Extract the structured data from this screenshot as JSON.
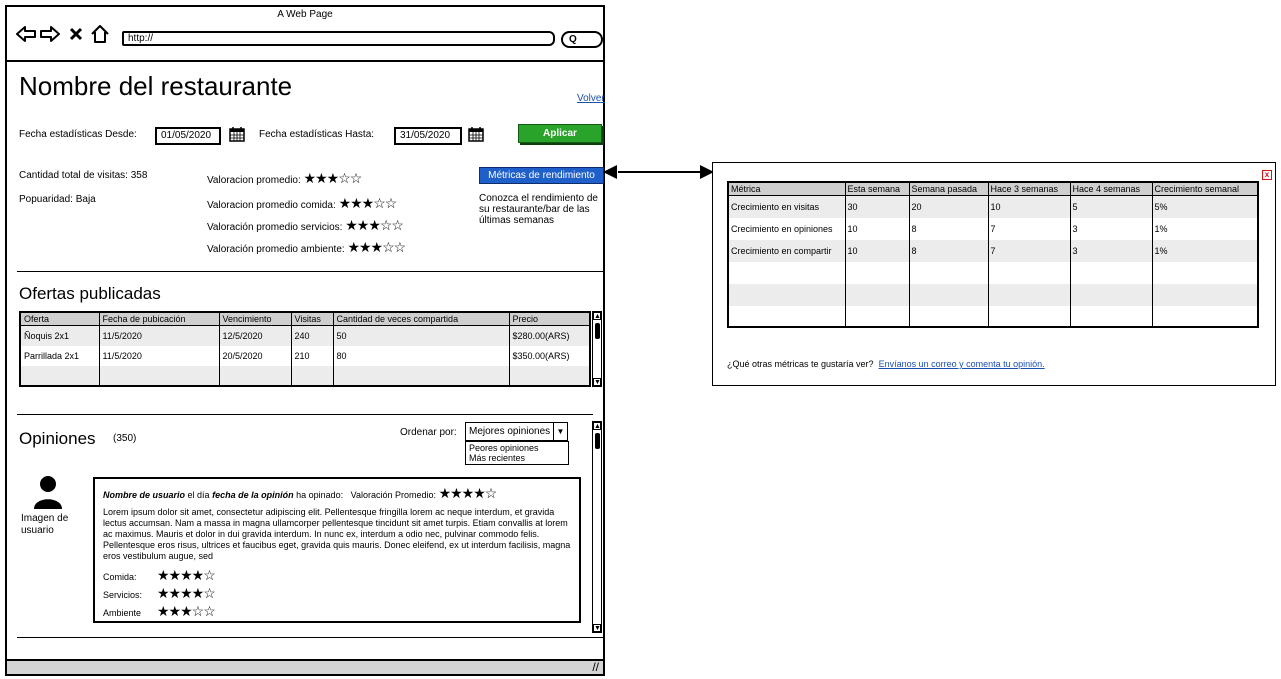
{
  "browser": {
    "title": "A Web Page",
    "url": "http://",
    "search_label": "Q"
  },
  "page": {
    "restaurant_name": "Nombre del restaurante",
    "volver": "Volver",
    "desde_label": "Fecha estadísticas Desde:",
    "desde_value": "01/05/2020",
    "hasta_label": "Fecha estadísticas Hasta:",
    "hasta_value": "31/05/2020",
    "aplicar": "Aplicar",
    "visitas": "Cantidad total de visitas: 358",
    "popularidad": "Popuaridad: Baja",
    "ratings": [
      {
        "label": "Valoracion promedio:",
        "stars": 3
      },
      {
        "label": "Valoracion promedio comida:",
        "stars": 3
      },
      {
        "label": "Valoración promedio servicios:",
        "stars": 3
      },
      {
        "label": "Valoración promedio ambiente:",
        "stars": 3
      }
    ],
    "metricas_button": "Métricas de rendimiento",
    "metricas_desc": "Conozca el rendimiento de su restaurante/bar de las últimas semanas"
  },
  "ofertas": {
    "title": "Ofertas publicadas",
    "columns": [
      "Oferta",
      "Fecha de pubicación",
      "Vencimiento",
      "Visitas",
      "Cantidad de veces compartida",
      "Precio"
    ],
    "rows": [
      [
        "Ñoquis 2x1",
        "11/5/2020",
        "12/5/2020",
        "240",
        "50",
        "$280.00(ARS)"
      ],
      [
        "Parrillada 2x1",
        "11/5/2020",
        "20/5/2020",
        "210",
        "80",
        "$350.00(ARS)"
      ]
    ]
  },
  "opiniones": {
    "title": "Opiniones",
    "count": "(350)",
    "ordenar_label": "Ordenar por:",
    "ordenar_selected": "Mejores opiniones",
    "ordenar_options": [
      "Peores opiniones",
      "Más recientes"
    ],
    "avatar_label": "Imagen de usuario",
    "review": {
      "user": "Nombre de usuario",
      "el_dia": "el día",
      "fecha": "fecha de la opinión",
      "ha_opinado": "ha opinado:",
      "valoracion_label": "Valoración Promedio:",
      "valoracion_stars": 4,
      "text": "Lorem ipsum dolor sit amet, consectetur adipiscing elit. Pellentesque fringilla lorem ac neque interdum, et gravida lectus accumsan. Nam a massa in magna ullamcorper pellentesque tincidunt sit amet turpis. Etiam convallis at lorem ac maximus. Mauris et dolor in dui gravida interdum. In nunc ex, interdum a odio nec, pulvinar commodo felis. Pellentesque eros risus, ultrices et faucibus eget, gravida quis mauris. Donec eleifend, ex ut interdum facilisis, magna eros vestibulum augue, sed",
      "sub_ratings": [
        {
          "label": "Comida:",
          "stars": 4
        },
        {
          "label": "Servicios:",
          "stars": 4
        },
        {
          "label": "Ambiente",
          "stars": 3
        }
      ]
    }
  },
  "metricas_popup": {
    "close": "x",
    "columns": [
      "Métrica",
      "Esta semana",
      "Semana pasada",
      "Hace 3 semanas",
      "Hace 4 semanas",
      "Crecimiento semanal"
    ],
    "rows": [
      [
        "Crecimiento en visitas",
        "30",
        "20",
        "10",
        "5",
        "5%"
      ],
      [
        "Crecimiento en opiniones",
        "10",
        "8",
        "7",
        "3",
        "1%"
      ],
      [
        "Crecimiento en compartir",
        "10",
        "8",
        "7",
        "3",
        "1%"
      ]
    ],
    "feedback_text": "¿Qué otras métricas te gustaría ver?",
    "feedback_link": "Envíanos un correo y comenta tu opinión."
  },
  "colors": {
    "aplicar": "#2aa32a",
    "metricas_button": "#1f5fc9",
    "link": "#1a4fb0",
    "close": "#dd1111"
  }
}
